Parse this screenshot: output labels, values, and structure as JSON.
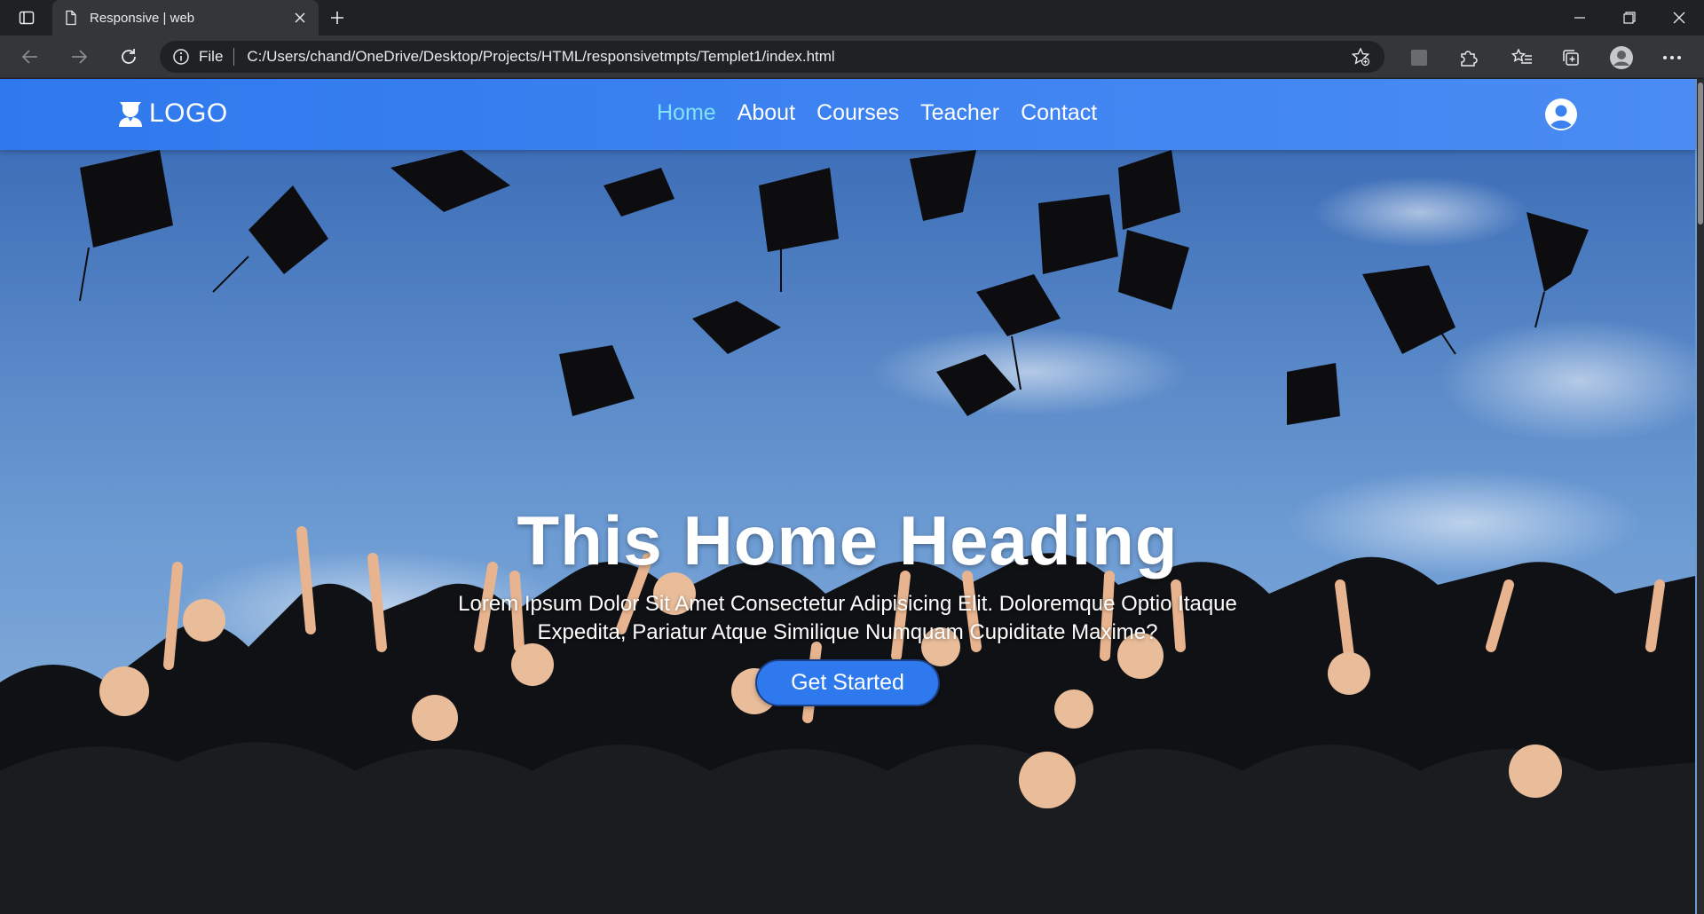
{
  "browser": {
    "tab": {
      "title": "Responsive | web"
    },
    "address": {
      "scheme": "File",
      "url": "C:/Users/chand/OneDrive/Desktop/Projects/HTML/responsivetmpts/Templet1/index.html"
    },
    "icons": [
      "sidebar-toggle-icon",
      "document-icon",
      "close-icon",
      "plus-icon",
      "back-arrow-icon",
      "forward-arrow-icon",
      "reload-icon",
      "info-icon",
      "add-favorite-icon",
      "extension-square-icon",
      "puzzle-icon",
      "favorites-icon",
      "collections-icon",
      "profile-icon",
      "more-icon",
      "minimize-icon",
      "restore-icon",
      "window-close-icon"
    ]
  },
  "site": {
    "logo": {
      "text": "LOGO",
      "icon": "graduate-icon"
    },
    "nav": {
      "items": [
        "Home",
        "About",
        "Courses",
        "Teacher",
        "Contact"
      ],
      "active": "Home"
    },
    "user_icon": "user-circle-icon",
    "colors": {
      "header": "#3b82f0",
      "active_link": "#7fe3f5",
      "button": "#2f79ee"
    }
  },
  "hero": {
    "title": "This Home Heading",
    "subtitle": "Lorem Ipsum Dolor Sit Amet Consectetur Adipisicing Elit. Doloremque Optio Itaque Expedita, Pariatur Atque Similique Numquam Cupiditate Maxime?",
    "button_label": "Get Started",
    "background": "graduates-throwing-caps-photo"
  }
}
